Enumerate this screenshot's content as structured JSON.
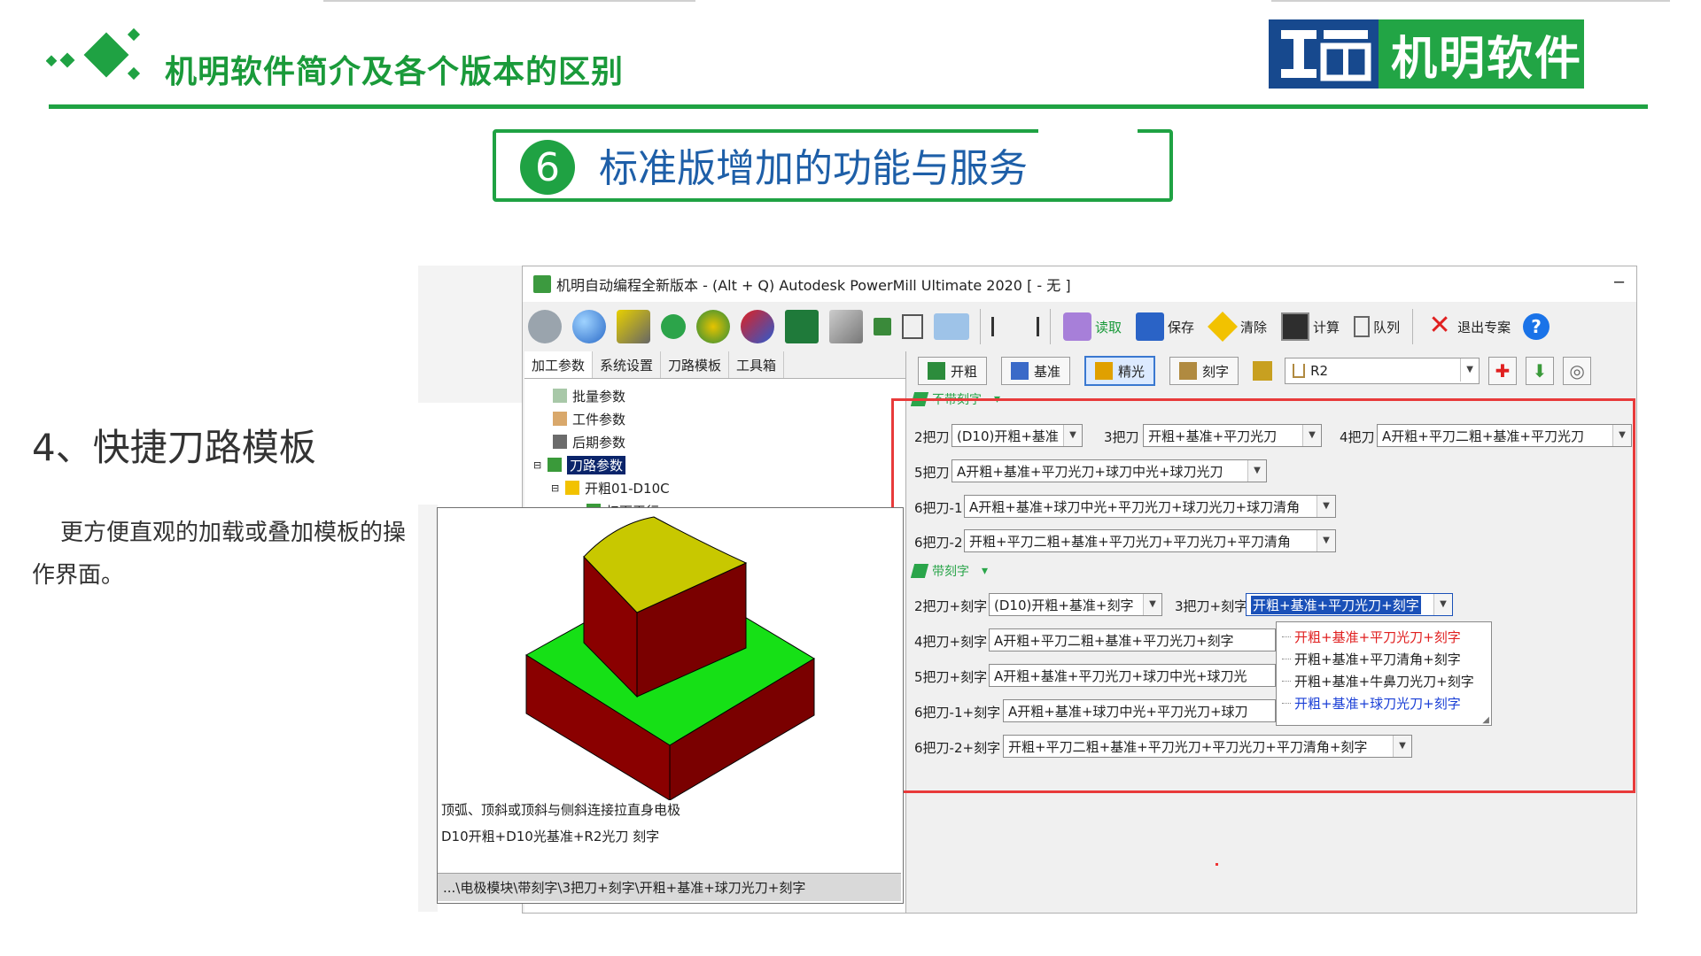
{
  "slide": {
    "title": "机明软件简介及各个版本的区别",
    "logo_text": "机明软件",
    "section_number": "6",
    "section_title": "标准版增加的功能与服务",
    "feature_title": "4、快捷刀路模板",
    "feature_desc": "更方便直观的加载或叠加模板的操作界面。"
  },
  "window": {
    "title": "机明自动编程全新版本 - (Alt + Q) Autodesk PowerMill Ultimate 2020    [ - 无 ]",
    "minimize_glyph": "─",
    "toolbar": {
      "read": "读取",
      "save": "保存",
      "clear": "清除",
      "calculate": "计算",
      "queue": "队列",
      "exit": "退出专案"
    },
    "left_tabs": [
      "加工参数",
      "系统设置",
      "刀路模板",
      "工具箱"
    ],
    "tree": [
      "批量参数",
      "工件参数",
      "后期参数",
      "刀路参数",
      "开粗01-D10C",
      "扫面平行"
    ],
    "mode_buttons": [
      "开粗",
      "基准",
      "精光",
      "刻字"
    ],
    "tool_select": "R2",
    "group_no_engrave": "不带刻字",
    "group_engrave": "带刻字",
    "rows_no_engrave": [
      {
        "label": "2把刀",
        "value": "(D10)开粗+基准"
      },
      {
        "label": "3把刀",
        "value": "开粗+基准+平刀光刀"
      },
      {
        "label": "4把刀",
        "value": "A开粗+平刀二粗+基准+平刀光刀"
      },
      {
        "label": "5把刀",
        "value": "A开粗+基准+平刀光刀+球刀中光+球刀光刀"
      },
      {
        "label": "6把刀-1",
        "value": "A开粗+基准+球刀中光+平刀光刀+球刀光刀+球刀清角"
      },
      {
        "label": "6把刀-2",
        "value": "开粗+平刀二粗+基准+平刀光刀+平刀光刀+平刀清角"
      }
    ],
    "rows_engrave": [
      {
        "label": "2把刀+刻字",
        "value": "(D10)开粗+基准+刻字"
      },
      {
        "label": "3把刀+刻字",
        "value": "开粗+基准+平刀光刀+刻字"
      },
      {
        "label": "4把刀+刻字",
        "value": "A开粗+平刀二粗+基准+平刀光刀+刻字"
      },
      {
        "label": "5把刀+刻字",
        "value": "A开粗+基准+平刀光刀+球刀中光+球刀光"
      },
      {
        "label": "6把刀-1+刻字",
        "value": "A开粗+基准+球刀中光+平刀光刀+球刀"
      },
      {
        "label": "6把刀-2+刻字",
        "value": "开粗+平刀二粗+基准+平刀光刀+平刀光刀+平刀清角+刻字"
      }
    ],
    "dropdown_options": [
      {
        "text": "开粗+基准+平刀光刀+刻字",
        "color": "#e02020"
      },
      {
        "text": "开粗+基准+平刀清角+刻字",
        "color": "#222222"
      },
      {
        "text": "开粗+基准+牛鼻刀光刀+刻字",
        "color": "#222222"
      },
      {
        "text": "开粗+基准+球刀光刀+刻字",
        "color": "#1a3fd6"
      }
    ]
  },
  "preview": {
    "caption_line1": "顶弧、顶斜或顶斜与侧斜连接拉直身电极",
    "caption_line2": "D10开粗+D10光基准+R2光刀  刻字",
    "path": "...\\电极模块\\带刻字\\3把刀+刻字\\开粗+基准+球刀光刀+刻字"
  },
  "colors": {
    "brand_green": "#1fa243",
    "brand_blue": "#17498e",
    "section_text": "#1e5fa8",
    "highlight_frame": "#e83a3a"
  }
}
